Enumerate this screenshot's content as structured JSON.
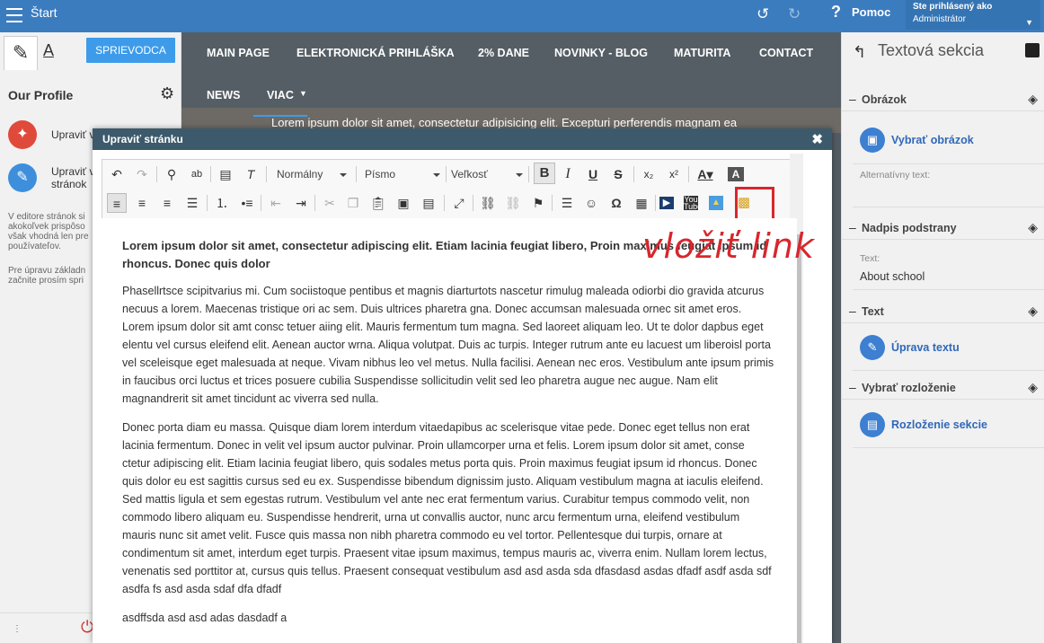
{
  "topbar": {
    "start": "Štart",
    "help": "Pomoc",
    "logged_label": "Ste prihlásený ako",
    "user": "Administrátor",
    "undo_icon": "↻",
    "redo_icon": "↻"
  },
  "left": {
    "guide_label": "SPRIEVODCA",
    "tab_text": "A",
    "profile_title": "Our Profile",
    "items": [
      {
        "label": "Upraviť v"
      },
      {
        "label": "Upraviť v\nstránok"
      }
    ],
    "note1": "V editore stránok si\nakokoľvek prispôso\nvšak vhodná len pre\npoužívateľov.",
    "note2": "Pre úpravu základn\nzačnite prosím spri"
  },
  "nav": {
    "items": [
      "MAIN PAGE",
      "ELEKTRONICKÁ PRIHLÁŠKA",
      "2% DANE",
      "NOVINKY - BLOG",
      "MATURITA",
      "CONTACT"
    ],
    "row2": [
      "NEWS",
      "VIAC"
    ],
    "hero": "Lorem ipsum dolor sit amet, consectetur adipisicing elit. Excepturi perferendis magnam ea"
  },
  "dialog": {
    "title": "Upraviť stránku",
    "format": "Normálny",
    "font": "Písmo",
    "size": "Veľkosť",
    "annotation": "vložiť link"
  },
  "document": {
    "heading": "Lorem ipsum dolor sit amet, consectetur adipiscing elit. Etiam lacinia feugiat libero, Proin maximus feugiat ipsum id rhoncus. Donec quis dolor",
    "p1": "Phasellrtsce scipitvarius mi. Cum sociistoque pentibus et magnis diarturtots nascetur rimulug maleada odiorbi dio gravida atcurus necuus a lorem. Maecenas tristique ori ac sem. Duis ultrices pharetra gna. Donec accumsan malesuada ornec sit amet eros. Lorem ipsum dolor sit amt consc tetuer aiing elit. Mauris fermentum tum magna. Sed laoreet aliquam leo. Ut te dolor dapbus eget elentu vel cursus eleifend elit. Aenean auctor wrna. Aliqua volutpat. Duis ac turpis. Integer rutrum ante eu lacuest um liberoisl porta vel sceleisque eget malesuada at neque. Vivam nibhus leo vel metus. Nulla facilisi. Aenean nec eros. Vestibulum ante ipsum primis in faucibus orci luctus et trices posuere cubilia Suspendisse sollicitudin velit sed leo pharetra augue nec augue. Nam elit magnandrerit sit amet tincidunt ac viverra sed nulla.",
    "p2": "Donec porta diam eu massa. Quisque diam lorem interdum vitaedapibus ac scelerisque vitae pede. Donec eget tellus non erat lacinia fermentum. Donec in velit vel ipsum auctor pulvinar. Proin ullamcorper urna et felis. Lorem ipsum dolor sit amet, conse ctetur adipiscing elit. Etiam lacinia feugiat libero, quis sodales metus porta quis. Proin maximus feugiat ipsum id rhoncus. Donec quis dolor eu est sagittis cursus sed eu ex. Suspendisse bibendum dignissim justo. Aliquam vestibulum magna at iaculis eleifend. Sed mattis ligula et sem egestas rutrum. Vestibulum vel ante nec erat fermentum varius. Curabitur tempus commodo velit, non commodo libero aliquam eu. Suspendisse hendrerit, urna ut convallis auctor, nunc arcu fermentum urna, eleifend vestibulum mauris nunc sit amet velit. Fusce quis massa non nibh pharetra commodo eu vel tortor. Pellentesque dui turpis, ornare at condimentum sit amet, interdum eget turpis. Praesent vitae ipsum maximus, tempus mauris ac, viverra enim. Nullam lorem lectus, venenatis sed porttitor at, cursus quis tellus. Praesent consequat vestibulum asd asd asda sda dfasdasd asdas dfadf asdf asda sdf asdfa fs asd asda sdaf dfa dfadf",
    "p3": "asdffsda asd asd adas dasdadf a"
  },
  "right": {
    "title": "Textová sekcia",
    "obrazok": "Obrázok",
    "vybrat_obrazok": "Vybrať obrázok",
    "alt": "Alternatívny text:",
    "nadpis": "Nadpis podstrany",
    "text_label": "Text:",
    "text_value": "About school",
    "text_section": "Text",
    "uprava": "Úprava textu",
    "rozlozenie": "Vybrať rozloženie",
    "rozlozenie_sekcie": "Rozloženie sekcie"
  },
  "colors": {
    "topbar": "#3b7cbf",
    "accent": "#3d9be9",
    "highlight": "#d8262c"
  }
}
